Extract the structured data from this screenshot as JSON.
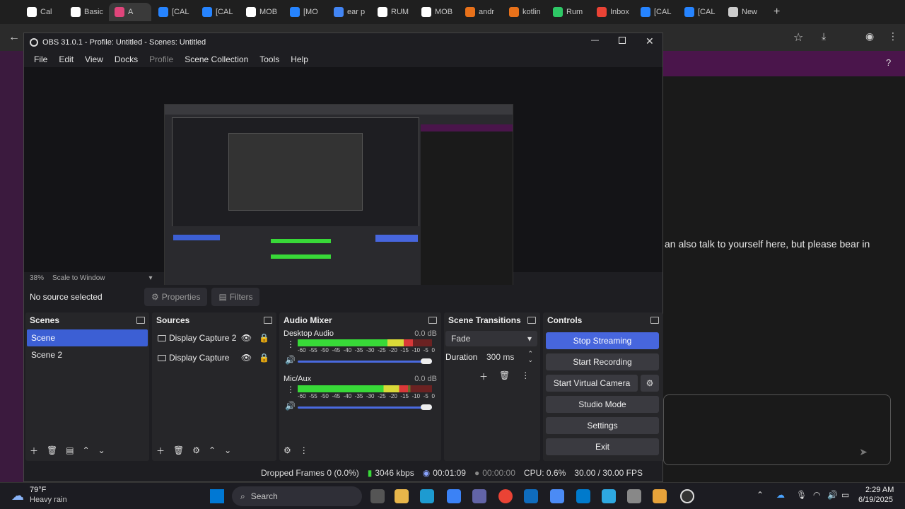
{
  "browser": {
    "tabs": [
      {
        "label": "Cal",
        "color": "#ffffff"
      },
      {
        "label": "Basic",
        "color": "#ffffff"
      },
      {
        "label": "A",
        "color": "#e0457b",
        "active": true
      },
      {
        "label": "[CAL",
        "color": "#2684ff"
      },
      {
        "label": "[CAL",
        "color": "#2684ff"
      },
      {
        "label": "MOB",
        "color": "#ffffff"
      },
      {
        "label": "[MO",
        "color": "#2684ff"
      },
      {
        "label": "ear p",
        "color": "#4285f4"
      },
      {
        "label": "RUM",
        "color": "#ffffff"
      },
      {
        "label": "MOB",
        "color": "#ffffff"
      },
      {
        "label": "andr",
        "color": "#e8711a"
      },
      {
        "label": "kotlin",
        "color": "#e8711a"
      },
      {
        "label": "Rum",
        "color": "#2ec866"
      },
      {
        "label": "Inbox",
        "color": "#ea4335"
      },
      {
        "label": "[CAL",
        "color": "#2684ff"
      },
      {
        "label": "[CAL",
        "color": "#2684ff"
      },
      {
        "label": "New",
        "color": "#cccccc"
      }
    ],
    "new_tab": "+"
  },
  "right_page": {
    "message": "an also talk to yourself here, but please bear in"
  },
  "obs": {
    "title": "OBS 31.0.1 - Profile: Untitled - Scenes: Untitled",
    "menu": [
      "File",
      "Edit",
      "View",
      "Docks",
      "Profile",
      "Scene Collection",
      "Tools",
      "Help"
    ],
    "zoom": "38%",
    "scale_mode": "Scale to Window",
    "source_status": "No source selected",
    "properties_label": "Properties",
    "filters_label": "Filters",
    "scenes": {
      "title": "Scenes",
      "items": [
        "Scene",
        "Scene 2"
      ],
      "selected": 0
    },
    "sources": {
      "title": "Sources",
      "items": [
        "Display Capture 2",
        "Display Capture"
      ]
    },
    "mixer": {
      "title": "Audio Mixer",
      "channels": [
        {
          "name": "Desktop Audio",
          "db": "0.0 dB",
          "level": 0.86
        },
        {
          "name": "Mic/Aux",
          "db": "0.0 dB",
          "level": 0.82
        }
      ],
      "ticks": [
        "-60",
        "-55",
        "-50",
        "-45",
        "-40",
        "-35",
        "-30",
        "-25",
        "-20",
        "-15",
        "-10",
        "-5",
        "0"
      ]
    },
    "transitions": {
      "title": "Scene Transitions",
      "type": "Fade",
      "duration_label": "Duration",
      "duration": "300 ms"
    },
    "controls": {
      "title": "Controls",
      "buttons": [
        "Stop Streaming",
        "Start Recording",
        "Start Virtual Camera",
        "Studio Mode",
        "Settings",
        "Exit"
      ]
    },
    "status": {
      "dropped": "Dropped Frames 0 (0.0%)",
      "bitrate": "3046 kbps",
      "stream_time": "00:01:09",
      "rec_time": "00:00:00",
      "cpu": "CPU: 0.6%",
      "fps": "30.00 / 30.00 FPS"
    }
  },
  "taskbar": {
    "weather_temp": "79°F",
    "weather_desc": "Heavy rain",
    "search_placeholder": "Search",
    "time": "2:29 AM",
    "date": "6/19/2025"
  }
}
